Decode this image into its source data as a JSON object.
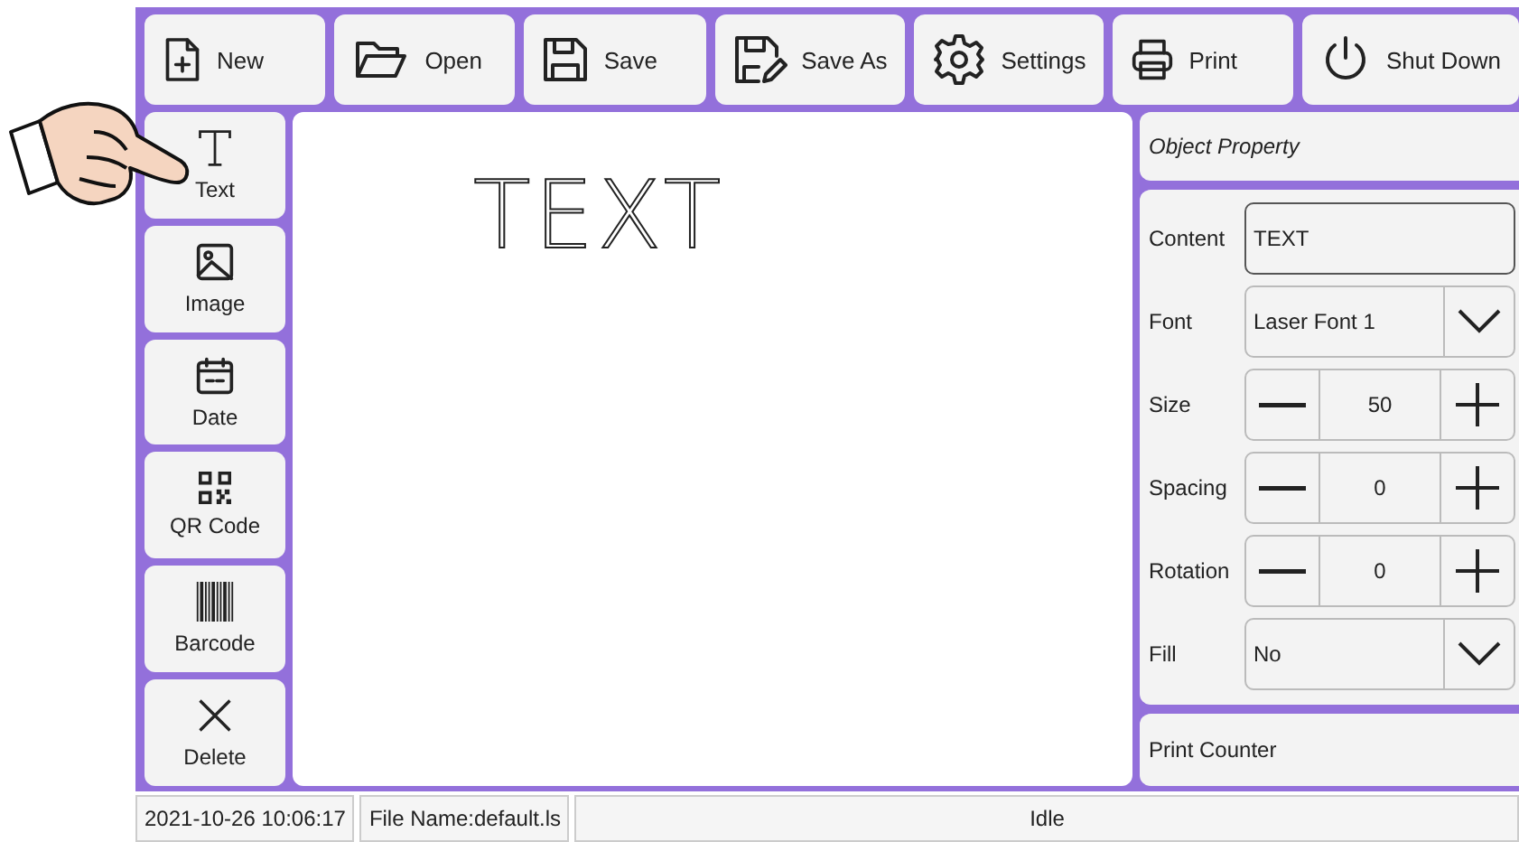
{
  "toolbar": [
    {
      "kind": "new",
      "label": "New"
    },
    {
      "kind": "open",
      "label": "Open"
    },
    {
      "kind": "save",
      "label": "Save"
    },
    {
      "kind": "saveas",
      "label": "Save As"
    },
    {
      "kind": "settings",
      "label": "Settings"
    },
    {
      "kind": "print",
      "label": "Print"
    },
    {
      "kind": "power",
      "label": "Shut Down"
    }
  ],
  "tools": [
    {
      "kind": "text",
      "label": "Text"
    },
    {
      "kind": "image",
      "label": "Image"
    },
    {
      "kind": "date",
      "label": "Date"
    },
    {
      "kind": "qr",
      "label": "QR Code"
    },
    {
      "kind": "barcode",
      "label": "Barcode"
    },
    {
      "kind": "delete",
      "label": "Delete"
    }
  ],
  "canvas": {
    "object_text": "TEXT"
  },
  "properties": {
    "title": "Object Property",
    "rows": [
      {
        "kind": "text",
        "label": "Content",
        "value": "TEXT"
      },
      {
        "kind": "dropdown",
        "label": "Font",
        "value": "Laser Font 1"
      },
      {
        "kind": "stepper",
        "label": "Size",
        "value": "50"
      },
      {
        "kind": "stepper",
        "label": "Spacing",
        "value": "0"
      },
      {
        "kind": "stepper",
        "label": "Rotation",
        "value": "0"
      },
      {
        "kind": "dropdown",
        "label": "Fill",
        "value": "No"
      }
    ],
    "footer": "Print Counter"
  },
  "status_bar": {
    "datetime": "2021-10-26 10:06:17",
    "file_name": "File Name:default.ls",
    "state": "Idle"
  }
}
